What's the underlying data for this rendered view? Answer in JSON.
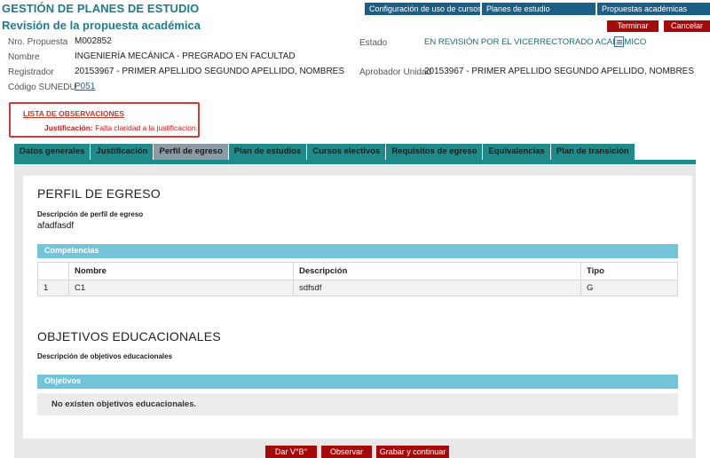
{
  "header": {
    "app_title": "GESTIÓN DE PLANES DE ESTUDIO",
    "page_title": "Revisión de la propuesta académica"
  },
  "top_nav": [
    "Configuración de uso de cursos",
    "Planes de estudio",
    "Propuestas académicas"
  ],
  "actions": {
    "terminar": "Terminar",
    "cancelar": "Cancelar"
  },
  "info": {
    "nro_label": "Nro. Propuesta",
    "nro_value": "M002852",
    "nombre_label": "Nombre",
    "nombre_value": "INGENIERÍA MECÁNICA - PREGRADO EN FACULTAD",
    "registrador_label": "Registrador",
    "registrador_value": "20153967 - PRIMER APELLIDO SEGUNDO APELLIDO, NOMBRES",
    "sunedu_label": "Código SUNEDU",
    "sunedu_value": "P051",
    "estado_label": "Estado",
    "estado_value": "EN REVISIÓN POR EL VICERRECTORADO ACADÉMICO",
    "aprobador_label": "Aprobador Unidad",
    "aprobador_value": "20153967 - PRIMER APELLIDO SEGUNDO APELLIDO, NOMBRES"
  },
  "observaciones": {
    "title": "LISTA DE OBSERVACIONES",
    "item_label": "Justificación:",
    "item_text": "Falta claridad a la justificacion."
  },
  "tabs": [
    {
      "label": "Datos generales",
      "active": false
    },
    {
      "label": "Justificación",
      "active": false
    },
    {
      "label": "Perfil de egreso",
      "active": true
    },
    {
      "label": "Plan de estudios",
      "active": false
    },
    {
      "label": "Cursos electivos",
      "active": false
    },
    {
      "label": "Requisitos de egreso",
      "active": false
    },
    {
      "label": "Equivalencias",
      "active": false
    },
    {
      "label": "Plan de transición",
      "active": false
    }
  ],
  "perfil": {
    "heading": "PERFIL DE EGRESO",
    "desc_label": "Descripción de perfil de egreso",
    "desc_value": "afadfasdf",
    "competencias_header": "Competencias",
    "columns": [
      "",
      "Nombre",
      "Descripción",
      "Tipo"
    ],
    "rows": [
      [
        "1",
        "C1",
        "sdfsdf",
        "G"
      ]
    ]
  },
  "objetivos": {
    "heading": "OBJETIVOS EDUCACIONALES",
    "desc_label": "Descripción de objetivos educacionales",
    "header": "Objetivos",
    "empty_text": "No existen objetivos educacionales."
  },
  "bottom_buttons": [
    "Dar V°B°",
    "Observar",
    "Grabar y continuar"
  ],
  "colors": {
    "teal_title": "#1f7a8c",
    "nav_blue": "#1c5f86",
    "button_red": "#a30b0b",
    "tab_teal": "#1f8a8a",
    "tab_active": "#8c9aa6",
    "grid_header": "#74c4d9",
    "observation_red": "#d43a3a"
  }
}
